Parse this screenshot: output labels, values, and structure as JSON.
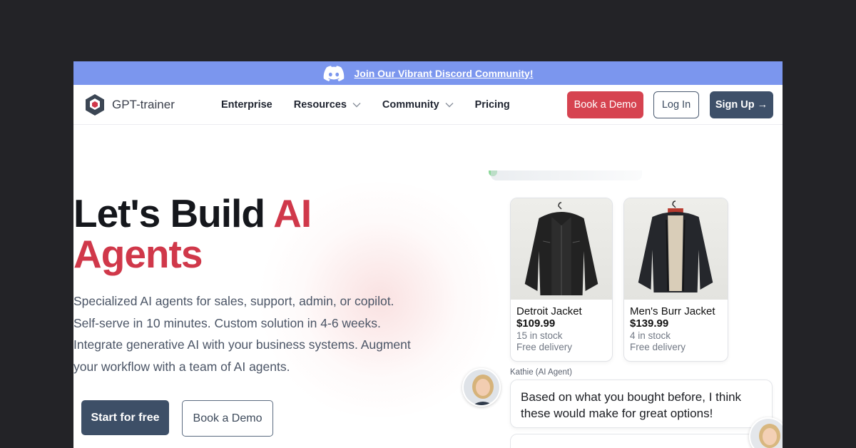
{
  "banner": {
    "link_text": "Join Our Vibrant Discord Community!",
    "icon": "discord-icon"
  },
  "nav": {
    "logo_text": "GPT-trainer",
    "items": [
      {
        "label": "Enterprise",
        "has_dropdown": false
      },
      {
        "label": "Resources",
        "has_dropdown": true
      },
      {
        "label": "Community",
        "has_dropdown": true
      },
      {
        "label": "Pricing",
        "has_dropdown": false
      }
    ],
    "book_demo": "Book a Demo",
    "login": "Log In",
    "signup": "Sign Up →"
  },
  "hero": {
    "headline_line1": "Let's Build ",
    "headline_accent1": "AI",
    "headline_accent2": "Agents",
    "desc": "Specialized AI agents for sales, support, admin, or copilot. Self-serve in 10 minutes. Custom solution in 4-6 weeks. Integrate generative AI with your business systems. Augment your workflow with a team of AI agents.",
    "cta_primary": "Start for free",
    "cta_secondary": "Book a Demo"
  },
  "products": [
    {
      "name": "Detroit Jacket",
      "price": "$109.99",
      "stock": "15 in stock",
      "delivery": "Free delivery"
    },
    {
      "name": "Men's Burr Jacket",
      "price": "$139.99",
      "stock": "4 in stock",
      "delivery": "Free delivery"
    }
  ],
  "chat": {
    "agent_label": "Kathie (AI Agent)",
    "message": "Based on what you bought before, I think these would make for great options!"
  },
  "colors": {
    "banner": "#7b96ee",
    "accent_red": "#d0384a",
    "primary_dark": "#3e5069",
    "demo_red": "#d64350"
  }
}
